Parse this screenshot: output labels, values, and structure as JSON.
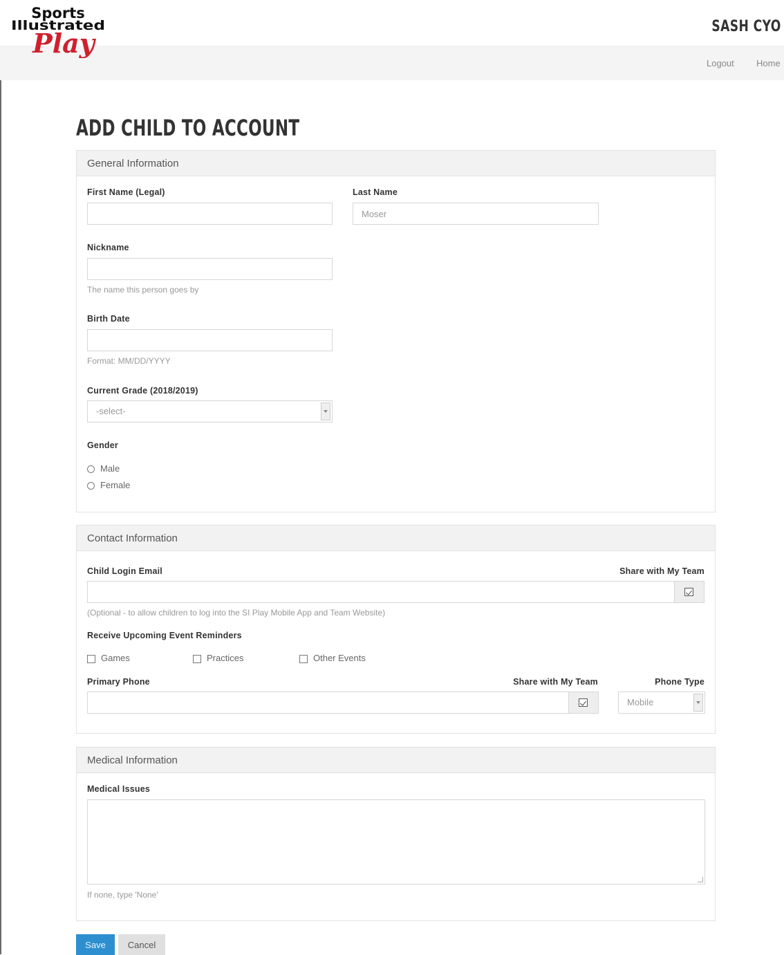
{
  "brand": {
    "logo_text_line1": "Sports",
    "logo_text_line2": "Illustrated",
    "logo_text_line3": "Play",
    "org_name": "SASH CYO",
    "accent_color": "#d0202e"
  },
  "nav": {
    "logout": "Logout",
    "home": "Home"
  },
  "page": {
    "title": "ADD CHILD TO ACCOUNT"
  },
  "general": {
    "heading": "General Information",
    "first_name": {
      "label": "First Name (Legal)",
      "value": ""
    },
    "last_name": {
      "label": "Last Name",
      "value": "Moser"
    },
    "nickname": {
      "label": "Nickname",
      "value": "",
      "help": "The name this person goes by"
    },
    "birth_date": {
      "label": "Birth Date",
      "value": "",
      "help": "Format: MM/DD/YYYY"
    },
    "grade": {
      "label": "Current Grade (2018/2019)",
      "selected": "-select-"
    },
    "gender": {
      "label": "Gender",
      "options": [
        "Male",
        "Female"
      ]
    }
  },
  "contact": {
    "heading": "Contact Information",
    "email": {
      "label": "Child Login Email",
      "share_label": "Share with My Team",
      "value": "",
      "help": "(Optional - to allow children to log into the SI Play Mobile App and Team Website)"
    },
    "reminders": {
      "label": "Receive Upcoming Event Reminders",
      "options": [
        "Games",
        "Practices",
        "Other Events"
      ]
    },
    "phone": {
      "label": "Primary Phone",
      "share_label": "Share with My Team",
      "value": ""
    },
    "phone_type": {
      "label": "Phone Type",
      "selected": "Mobile"
    }
  },
  "medical": {
    "heading": "Medical Information",
    "issues": {
      "label": "Medical Issues",
      "value": "",
      "help": "If none, type 'None'"
    }
  },
  "actions": {
    "save": "Save",
    "cancel": "Cancel",
    "save_color": "#2d8fcf"
  }
}
